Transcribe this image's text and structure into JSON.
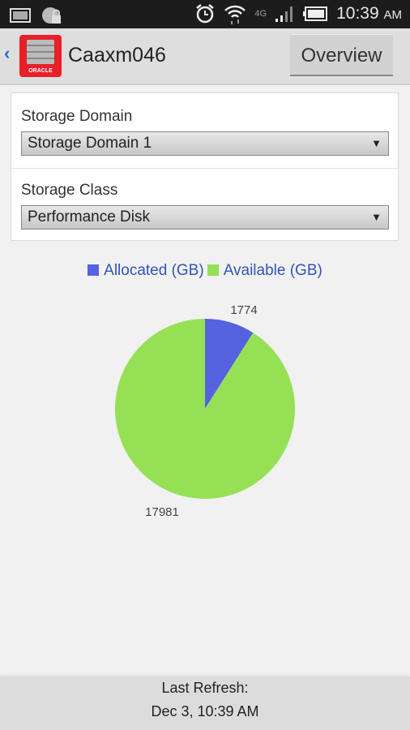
{
  "status_bar": {
    "time": "10:39",
    "ampm": "AM",
    "network": "4G",
    "icons": [
      "image-notification-icon",
      "vpn-lock-icon",
      "alarm-icon",
      "wifi-icon",
      "signal-icon",
      "battery-icon"
    ]
  },
  "app_bar": {
    "title": "Caaxm046",
    "logo_text": "ORACLE",
    "overview_label": "Overview",
    "back_glyph": "‹"
  },
  "filters": {
    "domain_label": "Storage Domain",
    "domain_value": "Storage Domain 1",
    "class_label": "Storage Class",
    "class_value": "Performance Disk",
    "arrow_glyph": "▼"
  },
  "chart_data": {
    "type": "pie",
    "title": "",
    "legend": [
      "Allocated (GB)",
      "Available (GB)"
    ],
    "legend_position": "top-center",
    "series": [
      {
        "name": "Allocated (GB)",
        "value": 1774,
        "color": "#5462e0"
      },
      {
        "name": "Available (GB)",
        "value": 17981,
        "color": "#96e056"
      }
    ],
    "start_angle": "12 o'clock",
    "direction": "clockwise",
    "data_labels": [
      "1774",
      "17981"
    ]
  },
  "footer": {
    "line1": "Last Refresh:",
    "line2": "Dec 3, 10:39 AM"
  }
}
